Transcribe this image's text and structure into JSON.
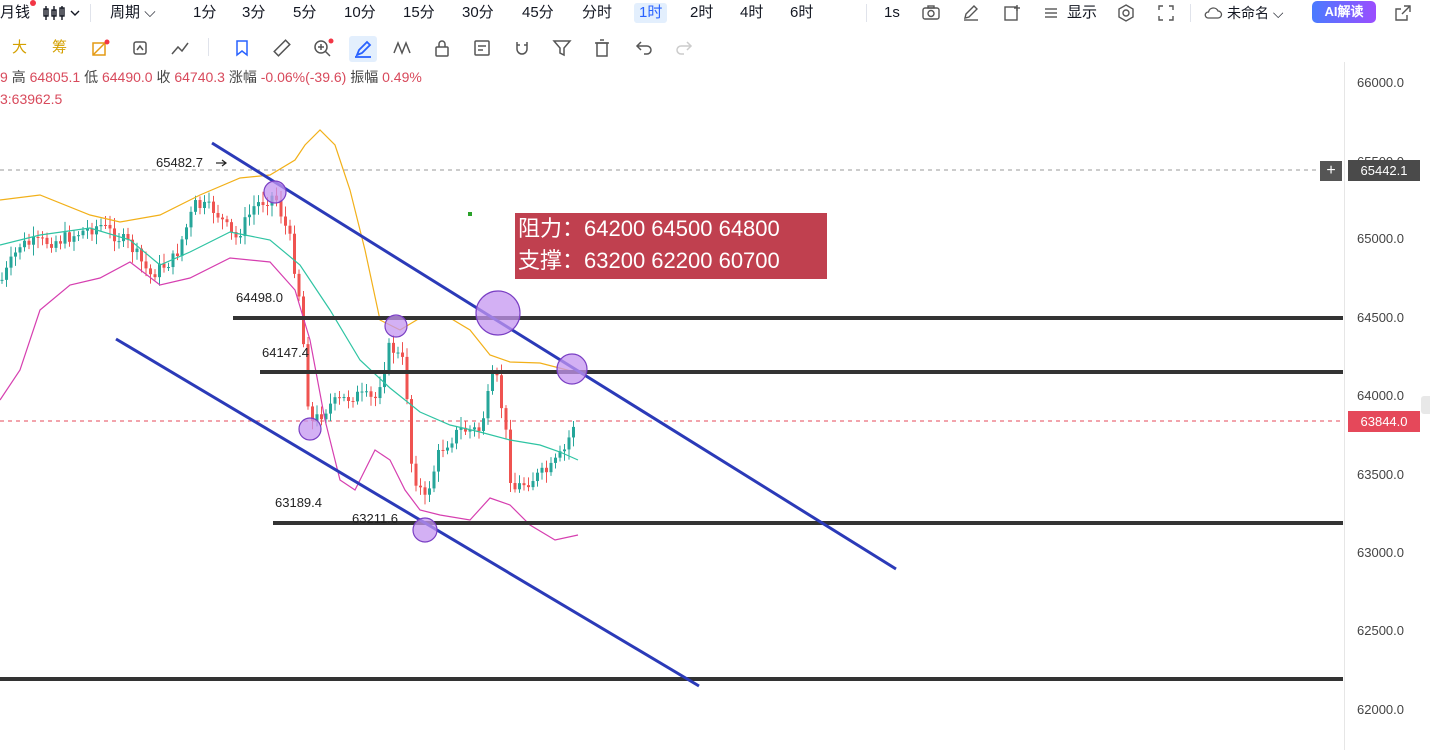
{
  "topbar": {
    "symbol_fragment": "月钱",
    "period_dropdown": "周期",
    "timeframes": [
      "1分",
      "3分",
      "5分",
      "10分",
      "15分",
      "30分",
      "45分",
      "分时",
      "1时",
      "2时",
      "4时",
      "6时"
    ],
    "active_timeframe": "1时",
    "interval_1s": "1s",
    "display_label": "显示",
    "layout_name": "未命名",
    "ai_button": "AI解读"
  },
  "toolbar2": {
    "btn_da": "大",
    "btn_chou": "筹"
  },
  "ohlc": {
    "open_tail": "9",
    "high_label": "高",
    "high": "64805.1",
    "low_label": "低",
    "low": "64490.0",
    "close_label": "收",
    "close": "64740.3",
    "change_label": "涨幅",
    "change": "-0.06%(-39.6)",
    "amplitude_label": "振幅",
    "amplitude": "0.49%"
  },
  "ma_text": "3:63962.5",
  "axis": {
    "labels": [
      "66000.0",
      "65500.0",
      "65000.0",
      "64500.0",
      "64000.0",
      "63500.0",
      "63000.0",
      "62500.0",
      "62000.0"
    ],
    "crosshair_price": "65442.1",
    "last_price": "63844.0"
  },
  "note": {
    "resistance": "阻力：64200 64500 64800",
    "support": "支撑：63200 62200 60700"
  },
  "levels": {
    "peak": "65482.7",
    "h1": "64498.0",
    "h2": "64147.4",
    "h3": "63189.4",
    "h4": "63211.6"
  },
  "colors": {
    "up": "#26a69a",
    "down": "#ef5350",
    "channel": "#2b3ab8",
    "level": "#333333",
    "boll_mid": "#2fc4a3",
    "boll_up": "#f2b019",
    "boll_dn": "#d63fb0",
    "note_bg": "#c0404f",
    "last_price": "#e5485a"
  },
  "chart_data": {
    "type": "candlestick",
    "timeframe": "1时",
    "price_range": [
      61900,
      66050
    ],
    "horizontal_levels": [
      64498.0,
      64147.4,
      63189.4,
      62200
    ],
    "resistance": [
      64200,
      64500,
      64800
    ],
    "support": [
      63200,
      62200,
      60700
    ],
    "last_price": 63844.0,
    "crosshair_price": 65442.1,
    "annotated_high": 65482.7,
    "annotated_low": 63211.6
  }
}
